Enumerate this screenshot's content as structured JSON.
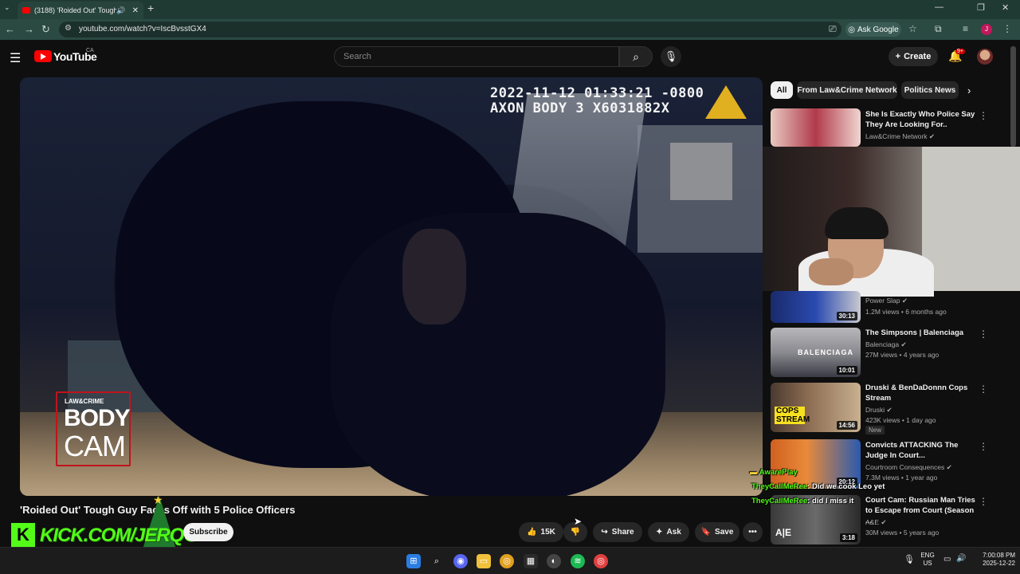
{
  "browser": {
    "tab_title": "(3188) 'Roided Out' Tough",
    "url": "youtube.com/watch?v=IscBvsstGX4",
    "ask_google": "Ask Google",
    "profile_initial": "J"
  },
  "youtube": {
    "logo_text": "YouTube",
    "region": "CA",
    "search_placeholder": "Search",
    "create_label": "Create",
    "notif_badge": "9+"
  },
  "video": {
    "timestamp": "2022-11-12 01:33:21 -0800",
    "device": "AXON BODY 3 X6031882X",
    "overlay_small": "LAW&CRIME",
    "overlay_line1": "BODY",
    "overlay_line2": "CAM",
    "title": "'Roided Out' Tough Guy Faces Off with 5 Police Officers",
    "like_count": "15K",
    "share_label": "Share",
    "ask_label": "Ask",
    "save_label": "Save",
    "subscribe_label": "Subscribe"
  },
  "streamer_overlay": {
    "kick_text": "KICK.COM/JERQO",
    "kick_letter": "K"
  },
  "chips": [
    "All",
    "From Law&Crime Network",
    "Politics News"
  ],
  "recommended": [
    {
      "title": "She Is Exactly Who Police Say They Are Looking For..",
      "channel": "Law&Crime Network",
      "meta": "",
      "duration": ""
    },
    {
      "title": "",
      "channel": "Power Slap",
      "meta": "1.2M views • 6 months ago",
      "duration": "30:13"
    },
    {
      "title": "The Simpsons | Balenciaga",
      "channel": "Balenciaga",
      "meta": "27M views • 4 years ago",
      "duration": "10:01",
      "thumb_text": "BALENCIAGA"
    },
    {
      "title": "Druski & BenDaDonnn Cops Stream",
      "channel": "Druski",
      "meta": "423K views • 1 day ago",
      "duration": "14:56",
      "tag": "New",
      "thumb_text": "COPS STREAM"
    },
    {
      "title": "Convicts ATTACKING The Judge In Court...",
      "channel": "Courtroom Consequences",
      "meta": "7.3M views • 1 year ago",
      "duration": "20:12"
    },
    {
      "title": "Court Cam: Russian Man Tries to Escape from Court (Season ...",
      "channel": "A&E",
      "meta": "30M views • 5 years ago",
      "duration": "3:18",
      "thumb_text": "A|E"
    }
  ],
  "chat": [
    {
      "user": "AwarePlay",
      "message": ""
    },
    {
      "user": "TheyCallMeRee",
      "message": ": Did we cook Leo yet"
    },
    {
      "user": "TheyCallMeRee",
      "message": ": did I miss it"
    }
  ],
  "taskbar": {
    "lang_top": "ENG",
    "lang_bottom": "US",
    "time": "7:00:08 PM",
    "date": "2025-12-22"
  },
  "colors": {
    "kick_green": "#53fc18",
    "youtube_red": "#ff0000",
    "bodycam_red": "#c0141c"
  }
}
